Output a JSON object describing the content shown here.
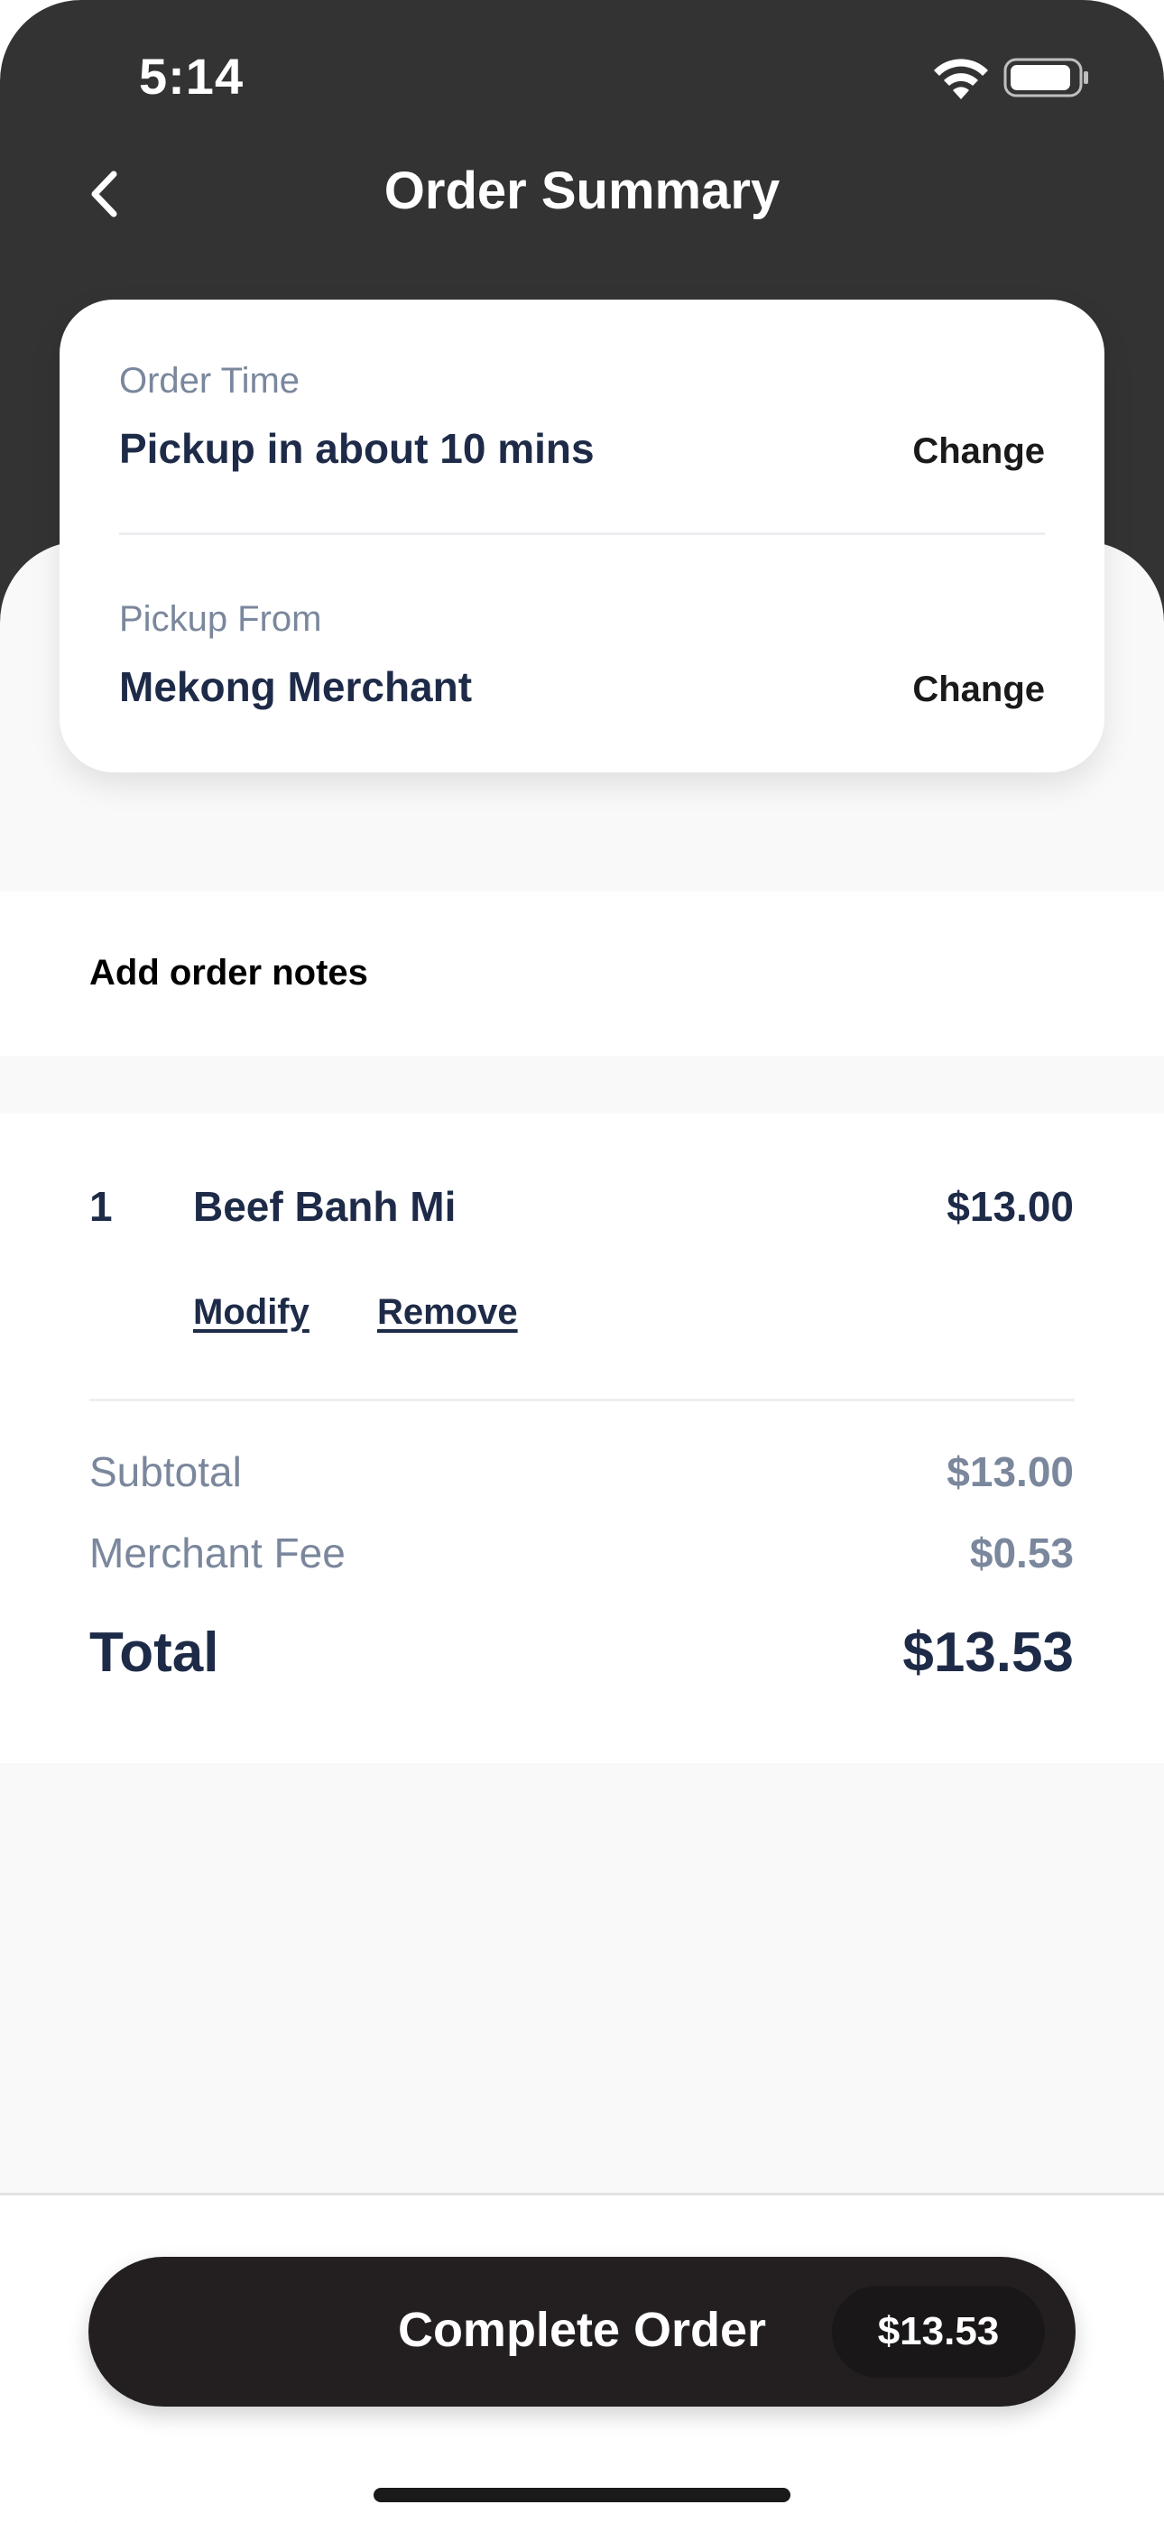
{
  "status_bar": {
    "time": "5:14"
  },
  "nav": {
    "title": "Order Summary",
    "back_icon": "chevron-left-icon"
  },
  "order_card": {
    "order_time": {
      "label": "Order Time",
      "value": "Pickup in about 10 mins",
      "change_label": "Change"
    },
    "pickup_from": {
      "label": "Pickup From",
      "value": "Mekong Merchant",
      "change_label": "Change"
    }
  },
  "notes": {
    "label": "Add order notes"
  },
  "items": [
    {
      "qty": "1",
      "name": "Beef Banh Mi",
      "price": "$13.00",
      "modify_label": "Modify",
      "remove_label": "Remove"
    }
  ],
  "summary": {
    "subtotal_label": "Subtotal",
    "subtotal_value": "$13.00",
    "fee_label": "Merchant Fee",
    "fee_value": "$0.53",
    "total_label": "Total",
    "total_value": "$13.53"
  },
  "checkout": {
    "button_label": "Complete Order",
    "button_price": "$13.53"
  },
  "colors": {
    "header_bg": "#333333",
    "text_primary": "#1e2b48",
    "text_muted": "#7a879c",
    "button_bg": "#231f20"
  }
}
